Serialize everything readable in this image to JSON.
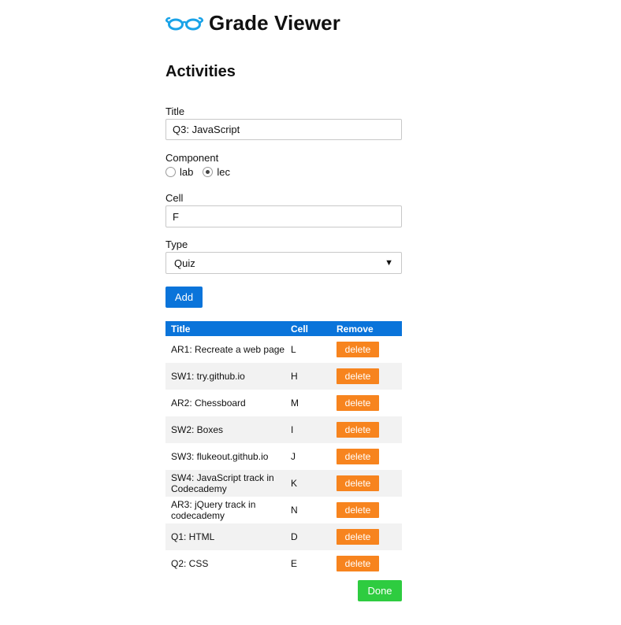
{
  "app": {
    "title": "Grade Viewer",
    "logo_icon": "glasses-icon",
    "accent": "#0a74da"
  },
  "section": {
    "title": "Activities"
  },
  "form": {
    "title_label": "Title",
    "title_value": "Q3: JavaScript",
    "component_label": "Component",
    "component_options": [
      "lab",
      "lec"
    ],
    "component_selected": "lec",
    "cell_label": "Cell",
    "cell_value": "F",
    "type_label": "Type",
    "type_selected": "Quiz",
    "add_label": "Add"
  },
  "table": {
    "headers": [
      "Title",
      "Cell",
      "Remove"
    ],
    "header_color": "#0a74da",
    "delete_label": "delete",
    "delete_color": "#f7841e",
    "rows": [
      {
        "title": "AR1: Recreate a web page",
        "cell": "L"
      },
      {
        "title": "SW1: try.github.io",
        "cell": "H"
      },
      {
        "title": "AR2: Chessboard",
        "cell": "M"
      },
      {
        "title": "SW2: Boxes",
        "cell": "I"
      },
      {
        "title": "SW3: flukeout.github.io",
        "cell": "J"
      },
      {
        "title": "SW4: JavaScript track in Codecademy",
        "cell": "K"
      },
      {
        "title": "AR3: jQuery track in codecademy",
        "cell": "N"
      },
      {
        "title": "Q1: HTML",
        "cell": "D"
      },
      {
        "title": "Q2: CSS",
        "cell": "E"
      }
    ]
  },
  "done_label": "Done",
  "done_color": "#2ecc40"
}
